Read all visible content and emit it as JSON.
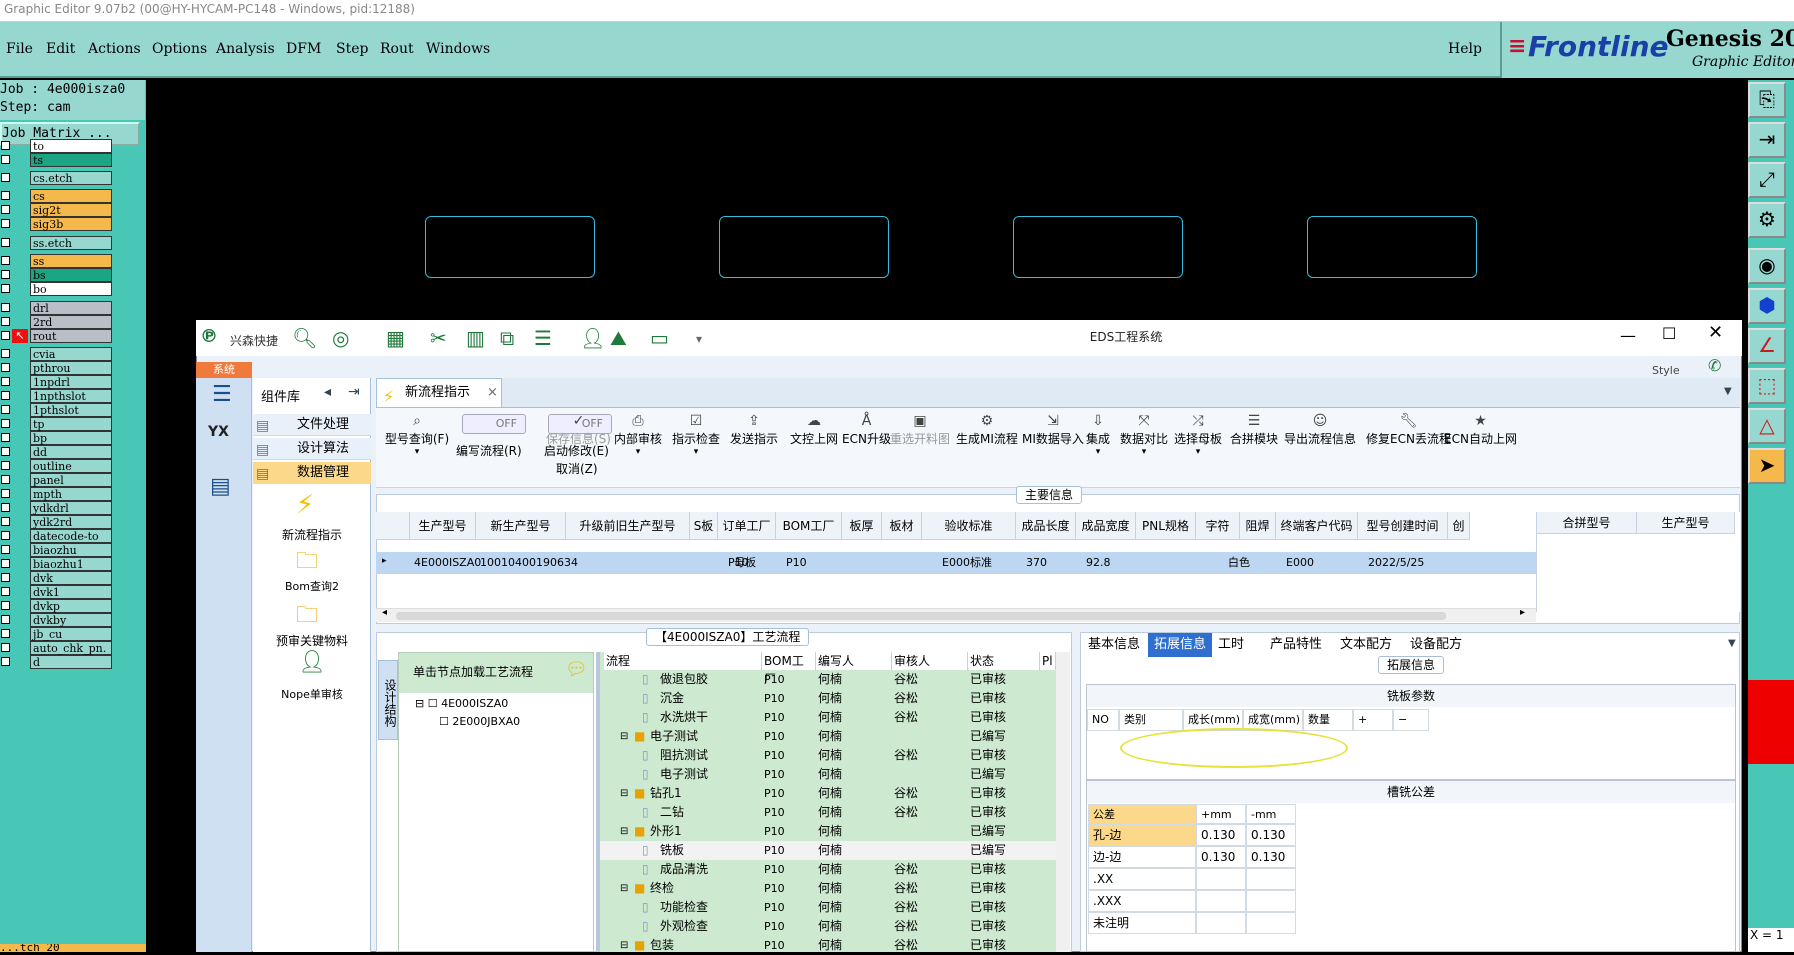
{
  "app": {
    "title": "Graphic Editor 9.07b2 (00@HY-HYCAM-PC148 - Windows, pid:12188)",
    "menu": [
      "File",
      "Edit",
      "Actions",
      "Options",
      "Analysis",
      "DFM",
      "Step",
      "Rout",
      "Windows"
    ],
    "help": "Help",
    "brand": "Frontline",
    "product": "Genesis 2000",
    "product_sub": "Graphic Editor"
  },
  "job": {
    "job_line": "Job : 4e000isza0",
    "step_line": "Step: cam",
    "matrix_btn": "Job Matrix ...",
    "layers": [
      {
        "name": "to",
        "color": "#ffffff"
      },
      {
        "name": "ts",
        "color": "#1ba582"
      },
      {
        "name": "cs.etch",
        "color": "#96d7d0"
      },
      {
        "name": "cs",
        "color": "#f5b84a"
      },
      {
        "name": "sig2t",
        "color": "#f5b84a"
      },
      {
        "name": "sig3b",
        "color": "#f5b84a"
      },
      {
        "name": "ss.etch",
        "color": "#96d7d0"
      },
      {
        "name": "ss",
        "color": "#f5b84a"
      },
      {
        "name": "bs",
        "color": "#1ba582"
      },
      {
        "name": "bo",
        "color": "#ffffff"
      },
      {
        "name": "drl",
        "color": "#b8bfc6"
      },
      {
        "name": "2rd",
        "color": "#b8bfc6"
      },
      {
        "name": "rout",
        "color": "#b8bfc6"
      },
      {
        "name": "cvia",
        "color": "#96d7d0"
      },
      {
        "name": "pthrou",
        "color": "#96d7d0"
      },
      {
        "name": "1npdrl",
        "color": "#96d7d0"
      },
      {
        "name": "1npthslot",
        "color": "#96d7d0"
      },
      {
        "name": "1pthslot",
        "color": "#96d7d0"
      },
      {
        "name": "tp",
        "color": "#96d7d0"
      },
      {
        "name": "bp",
        "color": "#96d7d0"
      },
      {
        "name": "dd",
        "color": "#96d7d0"
      },
      {
        "name": "outline",
        "color": "#96d7d0"
      },
      {
        "name": "panel",
        "color": "#96d7d0"
      },
      {
        "name": "mpth",
        "color": "#96d7d0"
      },
      {
        "name": "ydkdrl",
        "color": "#96d7d0"
      },
      {
        "name": "ydk2rd",
        "color": "#96d7d0"
      },
      {
        "name": "datecode-to",
        "color": "#96d7d0"
      },
      {
        "name": "biaozhu",
        "color": "#96d7d0"
      },
      {
        "name": "biaozhu1",
        "color": "#96d7d0"
      },
      {
        "name": "dvk",
        "color": "#96d7d0"
      },
      {
        "name": "dvk1",
        "color": "#96d7d0"
      },
      {
        "name": "dvkp",
        "color": "#96d7d0"
      },
      {
        "name": "dvkby",
        "color": "#96d7d0"
      },
      {
        "name": "jb_cu",
        "color": "#96d7d0"
      },
      {
        "name": "auto_chk_pn.",
        "color": "#96d7d0"
      },
      {
        "name": "d",
        "color": "#96d7d0"
      }
    ],
    "bottom_label": "...tch 20"
  },
  "statusbar": {
    "coord": "X = 1"
  },
  "eds": {
    "title": "EDS工程系统",
    "brand": "兴森快捷",
    "style_label": "Style",
    "sys_tab": "系统",
    "complib_title": "组件库",
    "complib_items": [
      "文件处理",
      "设计算法",
      "数据管理"
    ],
    "quick_items": [
      "新流程指示",
      "Bom查询2",
      "预审关键物料",
      "Nope单审核"
    ],
    "doc_tab": "新流程指示",
    "ribbon": {
      "type_query": "型号查询(F)",
      "edit_flow": "编写流程(R)",
      "enable_edit": "启动修改(E)",
      "cancel": "取消(Z)",
      "off": "OFF",
      "buttons": [
        "保存信息(S)",
        "内部审核",
        "指示检查",
        "发送指示",
        "文控上网",
        "ECN升级",
        "重选开料图",
        "生成MI流程",
        "MI数据导入",
        "集成",
        "数据对比",
        "选择母板",
        "合拼模块",
        "导出流程信息",
        "修复ECN丢流程",
        "ECN自动上网"
      ]
    },
    "main_info": {
      "title": "主要信息",
      "columns": [
        "生产型号",
        "新生产型号",
        "升级前旧生产型号",
        "S板",
        "订单工厂",
        "BOM工厂",
        "板厚",
        "板材",
        "验收标准",
        "成品长度",
        "成品宽度",
        "PNL规格",
        "字符",
        "阻焊",
        "终端客户代码",
        "型号创建时间",
        "创"
      ],
      "row": [
        "4E000ISZA0",
        "10010400190634",
        "",
        "母板",
        "P10",
        "P10",
        "",
        "",
        "E000标准",
        "370",
        "92.8",
        "",
        "白色",
        "",
        "E000",
        "2022/5/25",
        ""
      ],
      "side_columns": [
        "合拼型号",
        "生产型号"
      ]
    },
    "flow": {
      "title": "【4E000ISZA0】工艺流程",
      "side_tab": "设计结构",
      "hint": "单击节点加载工艺流程",
      "tree": [
        "4E000ISZA0",
        "2E000JBXA0"
      ],
      "columns": [
        "流程",
        "BOM工厂",
        "编写人",
        "审核人",
        "状态",
        "Pl"
      ],
      "rows": [
        {
          "name": "做退包胶",
          "indent": 2,
          "folder": false,
          "bom": "P10",
          "writer": "何楠",
          "reviewer": "谷松",
          "status": "已审核"
        },
        {
          "name": "沉金",
          "indent": 2,
          "folder": false,
          "bom": "P10",
          "writer": "何楠",
          "reviewer": "谷松",
          "status": "已审核"
        },
        {
          "name": "水洗烘干",
          "indent": 2,
          "folder": false,
          "bom": "P10",
          "writer": "何楠",
          "reviewer": "谷松",
          "status": "已审核"
        },
        {
          "name": "电子测试",
          "indent": 1,
          "folder": true,
          "bom": "P10",
          "writer": "何楠",
          "reviewer": "",
          "status": "已编写"
        },
        {
          "name": "阻抗测试",
          "indent": 2,
          "folder": false,
          "bom": "P10",
          "writer": "何楠",
          "reviewer": "谷松",
          "status": "已审核"
        },
        {
          "name": "电子测试",
          "indent": 2,
          "folder": false,
          "bom": "P10",
          "writer": "何楠",
          "reviewer": "",
          "status": "已编写"
        },
        {
          "name": "钻孔1",
          "indent": 1,
          "folder": true,
          "bom": "P10",
          "writer": "何楠",
          "reviewer": "谷松",
          "status": "已审核"
        },
        {
          "name": "二钻",
          "indent": 2,
          "folder": false,
          "bom": "P10",
          "writer": "何楠",
          "reviewer": "谷松",
          "status": "已审核"
        },
        {
          "name": "外形1",
          "indent": 1,
          "folder": true,
          "bom": "P10",
          "writer": "何楠",
          "reviewer": "",
          "status": "已编写"
        },
        {
          "name": "铣板",
          "indent": 2,
          "folder": false,
          "bom": "P10",
          "writer": "何楠",
          "reviewer": "",
          "status": "已编写"
        },
        {
          "name": "成品清洗",
          "indent": 2,
          "folder": false,
          "bom": "P10",
          "writer": "何楠",
          "reviewer": "谷松",
          "status": "已审核"
        },
        {
          "name": "终检",
          "indent": 1,
          "folder": true,
          "bom": "P10",
          "writer": "何楠",
          "reviewer": "谷松",
          "status": "已审核"
        },
        {
          "name": "功能检查",
          "indent": 2,
          "folder": false,
          "bom": "P10",
          "writer": "何楠",
          "reviewer": "谷松",
          "status": "已审核"
        },
        {
          "name": "外观检查",
          "indent": 2,
          "folder": false,
          "bom": "P10",
          "writer": "何楠",
          "reviewer": "谷松",
          "status": "已审核"
        },
        {
          "name": "包装",
          "indent": 1,
          "folder": true,
          "bom": "P10",
          "writer": "何楠",
          "reviewer": "谷松",
          "status": "已审核"
        }
      ]
    },
    "detail": {
      "tabs": [
        "基本信息",
        "拓展信息",
        "工时",
        "产品特性",
        "文本配方",
        "设备配方"
      ],
      "active_tab": "拓展信息",
      "section_title": "拓展信息",
      "mill_title": "铣板参数",
      "mill_columns": [
        "NO",
        "类别",
        "成长(mm)",
        "成宽(mm)",
        "数量",
        "+",
        "−"
      ],
      "tol_title": "槽铣公差",
      "tol_columns": [
        "公差",
        "+mm",
        "-mm"
      ],
      "tol_rows": [
        [
          "孔-边",
          "0.130",
          "0.130"
        ],
        [
          "边-边",
          "0.130",
          "0.130"
        ],
        [
          ".XX",
          "",
          ""
        ],
        [
          ".XXX",
          "",
          ""
        ],
        [
          "未注明",
          "",
          ""
        ]
      ]
    }
  }
}
